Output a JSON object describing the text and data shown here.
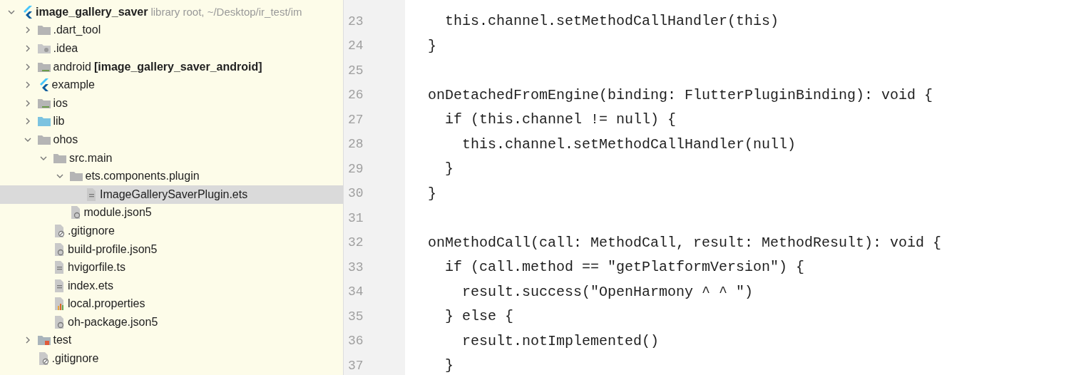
{
  "project_tree": {
    "items": [
      {
        "kind": "flutter",
        "label": "image_gallery_saver",
        "note": "library root, ~/Desktop/ir_test/im",
        "expanded": true,
        "selected": false,
        "children": [
          {
            "kind": "folder",
            "label": ".dart_tool",
            "expanded": false,
            "selected": false
          },
          {
            "kind": "idea",
            "label": ".idea",
            "expanded": false,
            "selected": false
          },
          {
            "kind": "module",
            "label": "android",
            "tag": "[image_gallery_saver_android]",
            "expanded": false,
            "selected": false
          },
          {
            "kind": "flutter",
            "label": "example",
            "expanded": false,
            "selected": false
          },
          {
            "kind": "module",
            "label": "ios",
            "expanded": false,
            "selected": false
          },
          {
            "kind": "source",
            "label": "lib",
            "expanded": false,
            "selected": false
          },
          {
            "kind": "folder",
            "label": "ohos",
            "expanded": true,
            "selected": false,
            "children": [
              {
                "kind": "folder",
                "label": "src.main",
                "expanded": true,
                "selected": false,
                "children": [
                  {
                    "kind": "folder",
                    "label": "ets.components.plugin",
                    "expanded": true,
                    "selected": false,
                    "children": [
                      {
                        "kind": "text",
                        "label": "ImageGallerySaverPlugin.ets",
                        "selected": true
                      }
                    ]
                  },
                  {
                    "kind": "config",
                    "label": "module.json5",
                    "selected": false
                  }
                ]
              },
              {
                "kind": "ignore",
                "label": ".gitignore",
                "selected": false
              },
              {
                "kind": "config",
                "label": "build-profile.json5",
                "selected": false
              },
              {
                "kind": "text",
                "label": "hvigorfile.ts",
                "selected": false
              },
              {
                "kind": "text",
                "label": "index.ets",
                "selected": false
              },
              {
                "kind": "properties",
                "label": "local.properties",
                "selected": false
              },
              {
                "kind": "config",
                "label": "oh-package.json5",
                "selected": false
              }
            ]
          },
          {
            "kind": "test",
            "label": "test",
            "expanded": false,
            "selected": false
          },
          {
            "kind": "ignore",
            "label": ".gitignore",
            "selected": false
          }
        ]
      }
    ]
  },
  "editor": {
    "lines": [
      {
        "number": "23",
        "code": "  this.channel.setMethodCallHandler(this)"
      },
      {
        "number": "24",
        "code": "}"
      },
      {
        "number": "25"
      },
      {
        "number": "26",
        "code": "onDetachedFromEngine(binding: FlutterPluginBinding): void {"
      },
      {
        "number": "27",
        "code": "  if (this.channel != null) {"
      },
      {
        "number": "28",
        "code": "    this.channel.setMethodCallHandler(null)"
      },
      {
        "number": "29",
        "code": "  }"
      },
      {
        "number": "30",
        "code": "}"
      },
      {
        "number": "31"
      },
      {
        "number": "32",
        "code": "onMethodCall(call: MethodCall, result: MethodResult): void {"
      },
      {
        "number": "33",
        "code": "  if (call.method == \"getPlatformVersion\") {"
      },
      {
        "number": "34",
        "code": "    result.success(\"OpenHarmony ^ ^ \")"
      },
      {
        "number": "35",
        "code": "  } else {"
      },
      {
        "number": "36",
        "code": "    result.notImplemented()"
      },
      {
        "number": "37",
        "code": "  }"
      }
    ]
  }
}
